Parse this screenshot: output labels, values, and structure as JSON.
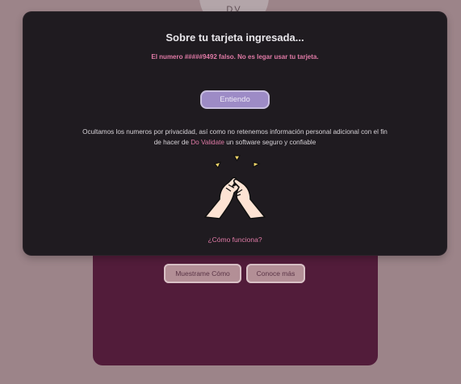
{
  "background": {
    "logo_text": "DV",
    "buttons": [
      "Muestrame Cómo",
      "Conoce más"
    ]
  },
  "modal": {
    "title": "Sobre tu tarjeta ingresada...",
    "warning": "El numero #####9492 falso. No es legar usar tu tarjeta.",
    "ok_label": "Entiendo",
    "privacy_before": "Ocultamos los numeros por privacidad, así como no retenemos información personal adicional con el fin de hacer de ",
    "privacy_brand": "Do Validate",
    "privacy_after": " un software seguro y confiable",
    "help_link": "¿Cómo funciona?",
    "illustration_icon": "clasped-hands-icon"
  },
  "colors": {
    "page_bg": "#9c8489",
    "modal_bg": "#1f1b20",
    "accent_pink": "#e07aa6",
    "button_purple": "#9d8bc6",
    "panel_bg": "#521c3a"
  }
}
